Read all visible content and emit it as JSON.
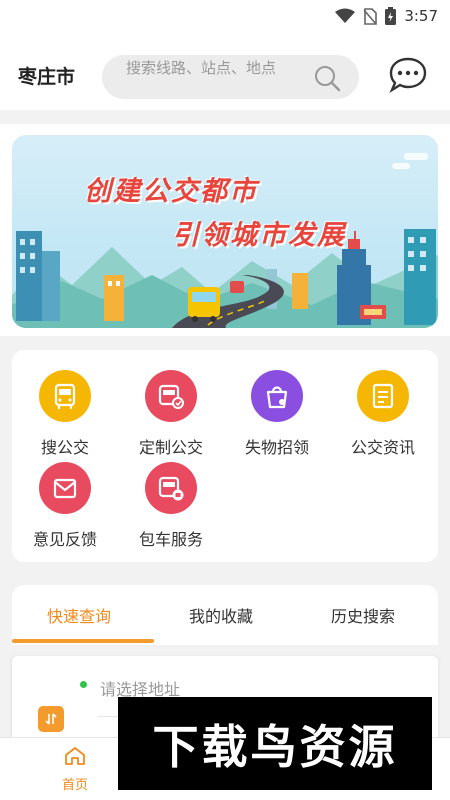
{
  "status_bar": {
    "time": "3:57"
  },
  "header": {
    "city": "枣庄市",
    "search_placeholder": "搜索线路、站点、地点"
  },
  "banner": {
    "line1": "创建公交都市",
    "line2": "引领城市发展"
  },
  "functions": [
    {
      "label": "搜公交",
      "icon": "bus-search-icon",
      "color": "#f6b704"
    },
    {
      "label": "定制公交",
      "icon": "custom-bus-icon",
      "color": "#e84a5f"
    },
    {
      "label": "失物招领",
      "icon": "lost-found-bag-icon",
      "color": "#8a4fe0"
    },
    {
      "label": "公交资讯",
      "icon": "news-icon",
      "color": "#f6b704"
    },
    {
      "label": "意见反馈",
      "icon": "feedback-mail-icon",
      "color": "#e84a5f"
    },
    {
      "label": "包车服务",
      "icon": "charter-bus-icon",
      "color": "#e84a5f"
    }
  ],
  "tabs": [
    {
      "label": "快速查询",
      "active": true
    },
    {
      "label": "我的收藏",
      "active": false
    },
    {
      "label": "历史搜索",
      "active": false
    }
  ],
  "query": {
    "placeholder": "请选择地址"
  },
  "bottom_nav": {
    "home_label": "首页"
  },
  "watermark": {
    "text": "下载鸟资源"
  },
  "colors": {
    "accent": "#f08a1c",
    "banner_text": "#e8453c"
  }
}
